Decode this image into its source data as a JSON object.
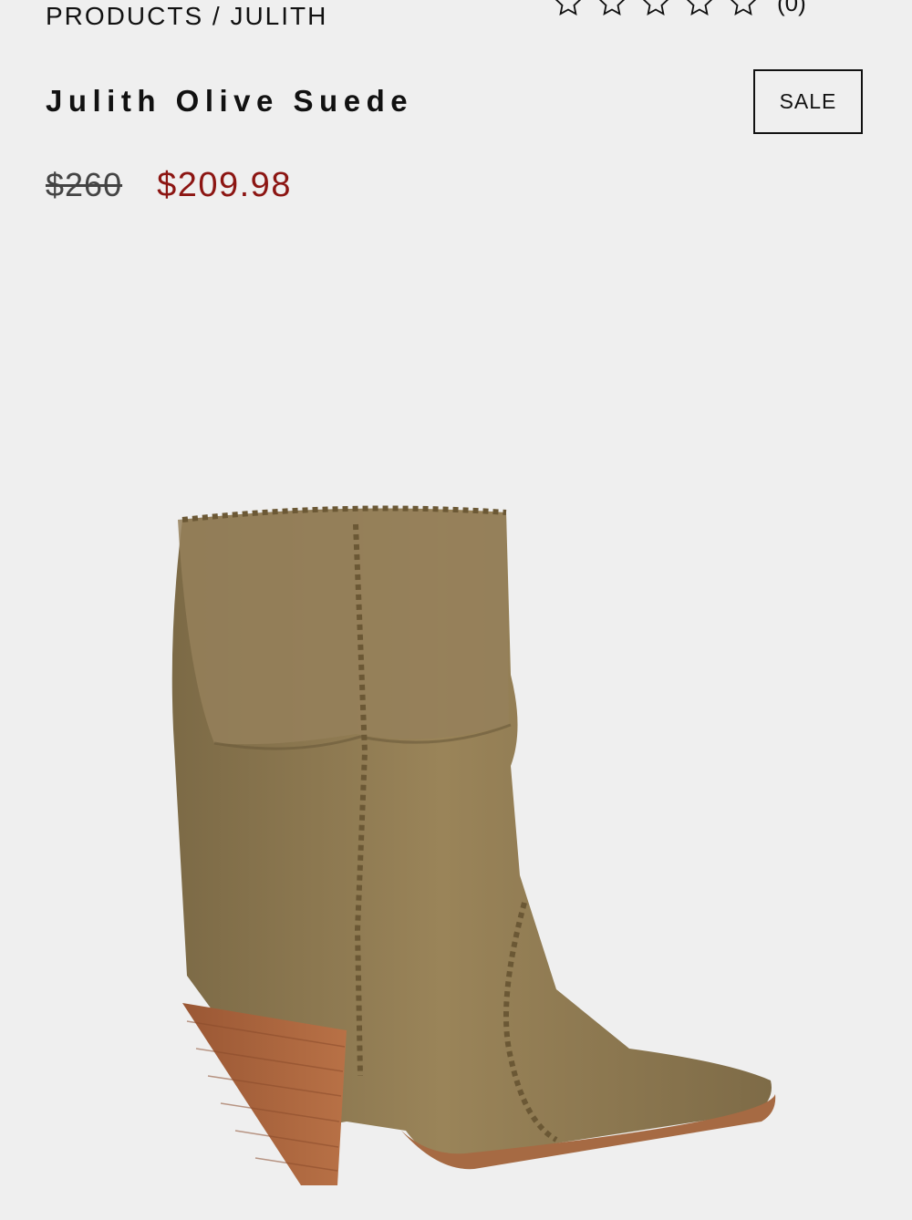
{
  "breadcrumb": "PRODUCTS / JULITH",
  "rating": {
    "stars": 0,
    "max_stars": 5,
    "count_label": "(0)"
  },
  "product": {
    "title": "Julith Olive Suede",
    "badge": "SALE",
    "original_price": "$260",
    "sale_price": "$209.98"
  },
  "colors": {
    "sale_price": "#8c1512",
    "suede": "#8f7a52",
    "heel": "#a8623b"
  },
  "icons": {
    "star": "star-outline-icon"
  }
}
